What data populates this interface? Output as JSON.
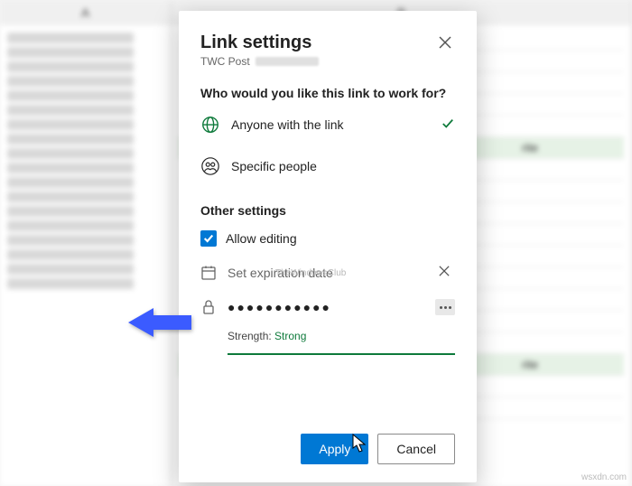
{
  "background": {
    "col_a_header": "A",
    "col_b_header": "B",
    "cell_fragment": "rite"
  },
  "dialog": {
    "title": "Link settings",
    "subtitle_prefix": "TWC Post",
    "question": "Who would you like this link to work for?",
    "options": {
      "anyone": "Anyone with the link",
      "specific": "Specific people"
    },
    "other_settings_title": "Other settings",
    "allow_editing": {
      "label": "Allow editing",
      "checked": true
    },
    "expiration": {
      "placeholder": "Set expiration date"
    },
    "password": {
      "value_mask": "●●●●●●●●●●●",
      "strength_label": "Strength:",
      "strength_value": "Strong"
    },
    "buttons": {
      "apply": "Apply",
      "cancel": "Cancel"
    }
  },
  "watermark": "TheWindowsClub",
  "footer_watermark": "wsxdn.com"
}
